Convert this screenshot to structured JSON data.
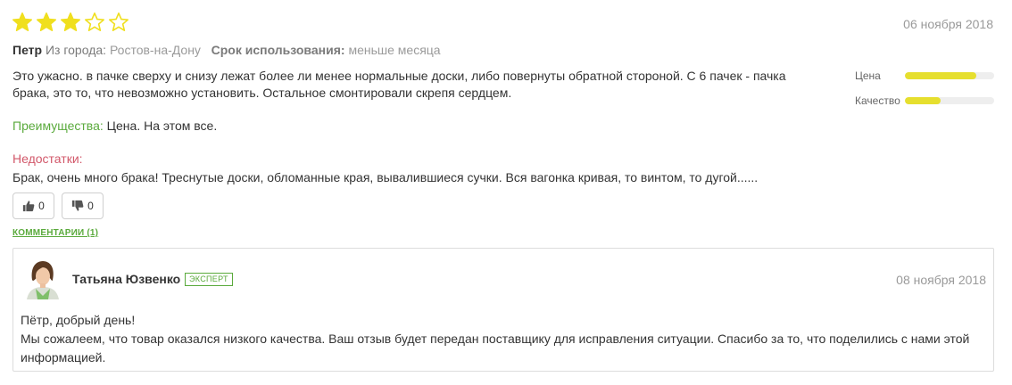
{
  "review": {
    "rating": 3,
    "max_rating": 5,
    "date": "06 ноября 2018",
    "author": "Петр",
    "city_label": "Из города:",
    "city": "Ростов-на-Дону",
    "usage_label": "Срок использования:",
    "usage": "меньше месяца",
    "text": "Это ужасно. в пачке сверху и снизу лежат более ли менее нормальные доски, либо повернуты обратной стороной. С 6 пачек - пачка брака, это то, что невозможно установить. Остальное смонтировали скрепя сердцем.",
    "pros_label": "Преимущества:",
    "pros": "Цена. На этом все.",
    "cons_label": "Недостатки:",
    "cons": "Брак, очень много брака! Треснутые доски, обломанные края, вывалившиеся сучки. Вся вагонка кривая, то винтом, то дугой......",
    "likes": "0",
    "dislikes": "0",
    "comments_link": "КОММЕНТАРИИ (1)"
  },
  "ratings": [
    {
      "label": "Цена",
      "value": 0.8
    },
    {
      "label": "Качество",
      "value": 0.4
    }
  ],
  "reply": {
    "author": "Татьяна Юзвенко",
    "badge": "ЭКСПЕРТ",
    "date": "08 ноября 2018",
    "greeting": "Пётр, добрый день!",
    "text": "Мы сожалеем, что товар оказался низкого качества. Ваш отзыв будет передан поставщику для исправления ситуации. Спасибо за то, что поделились с нами этой информацией."
  },
  "colors": {
    "star": "#f0df1e",
    "accent_green": "#5aaa3c",
    "cons_red": "#d2586a",
    "bar_fill": "#e6df2e"
  },
  "icons": [
    "star-filled-icon",
    "star-empty-icon",
    "thumbs-up-icon",
    "thumbs-down-icon"
  ]
}
